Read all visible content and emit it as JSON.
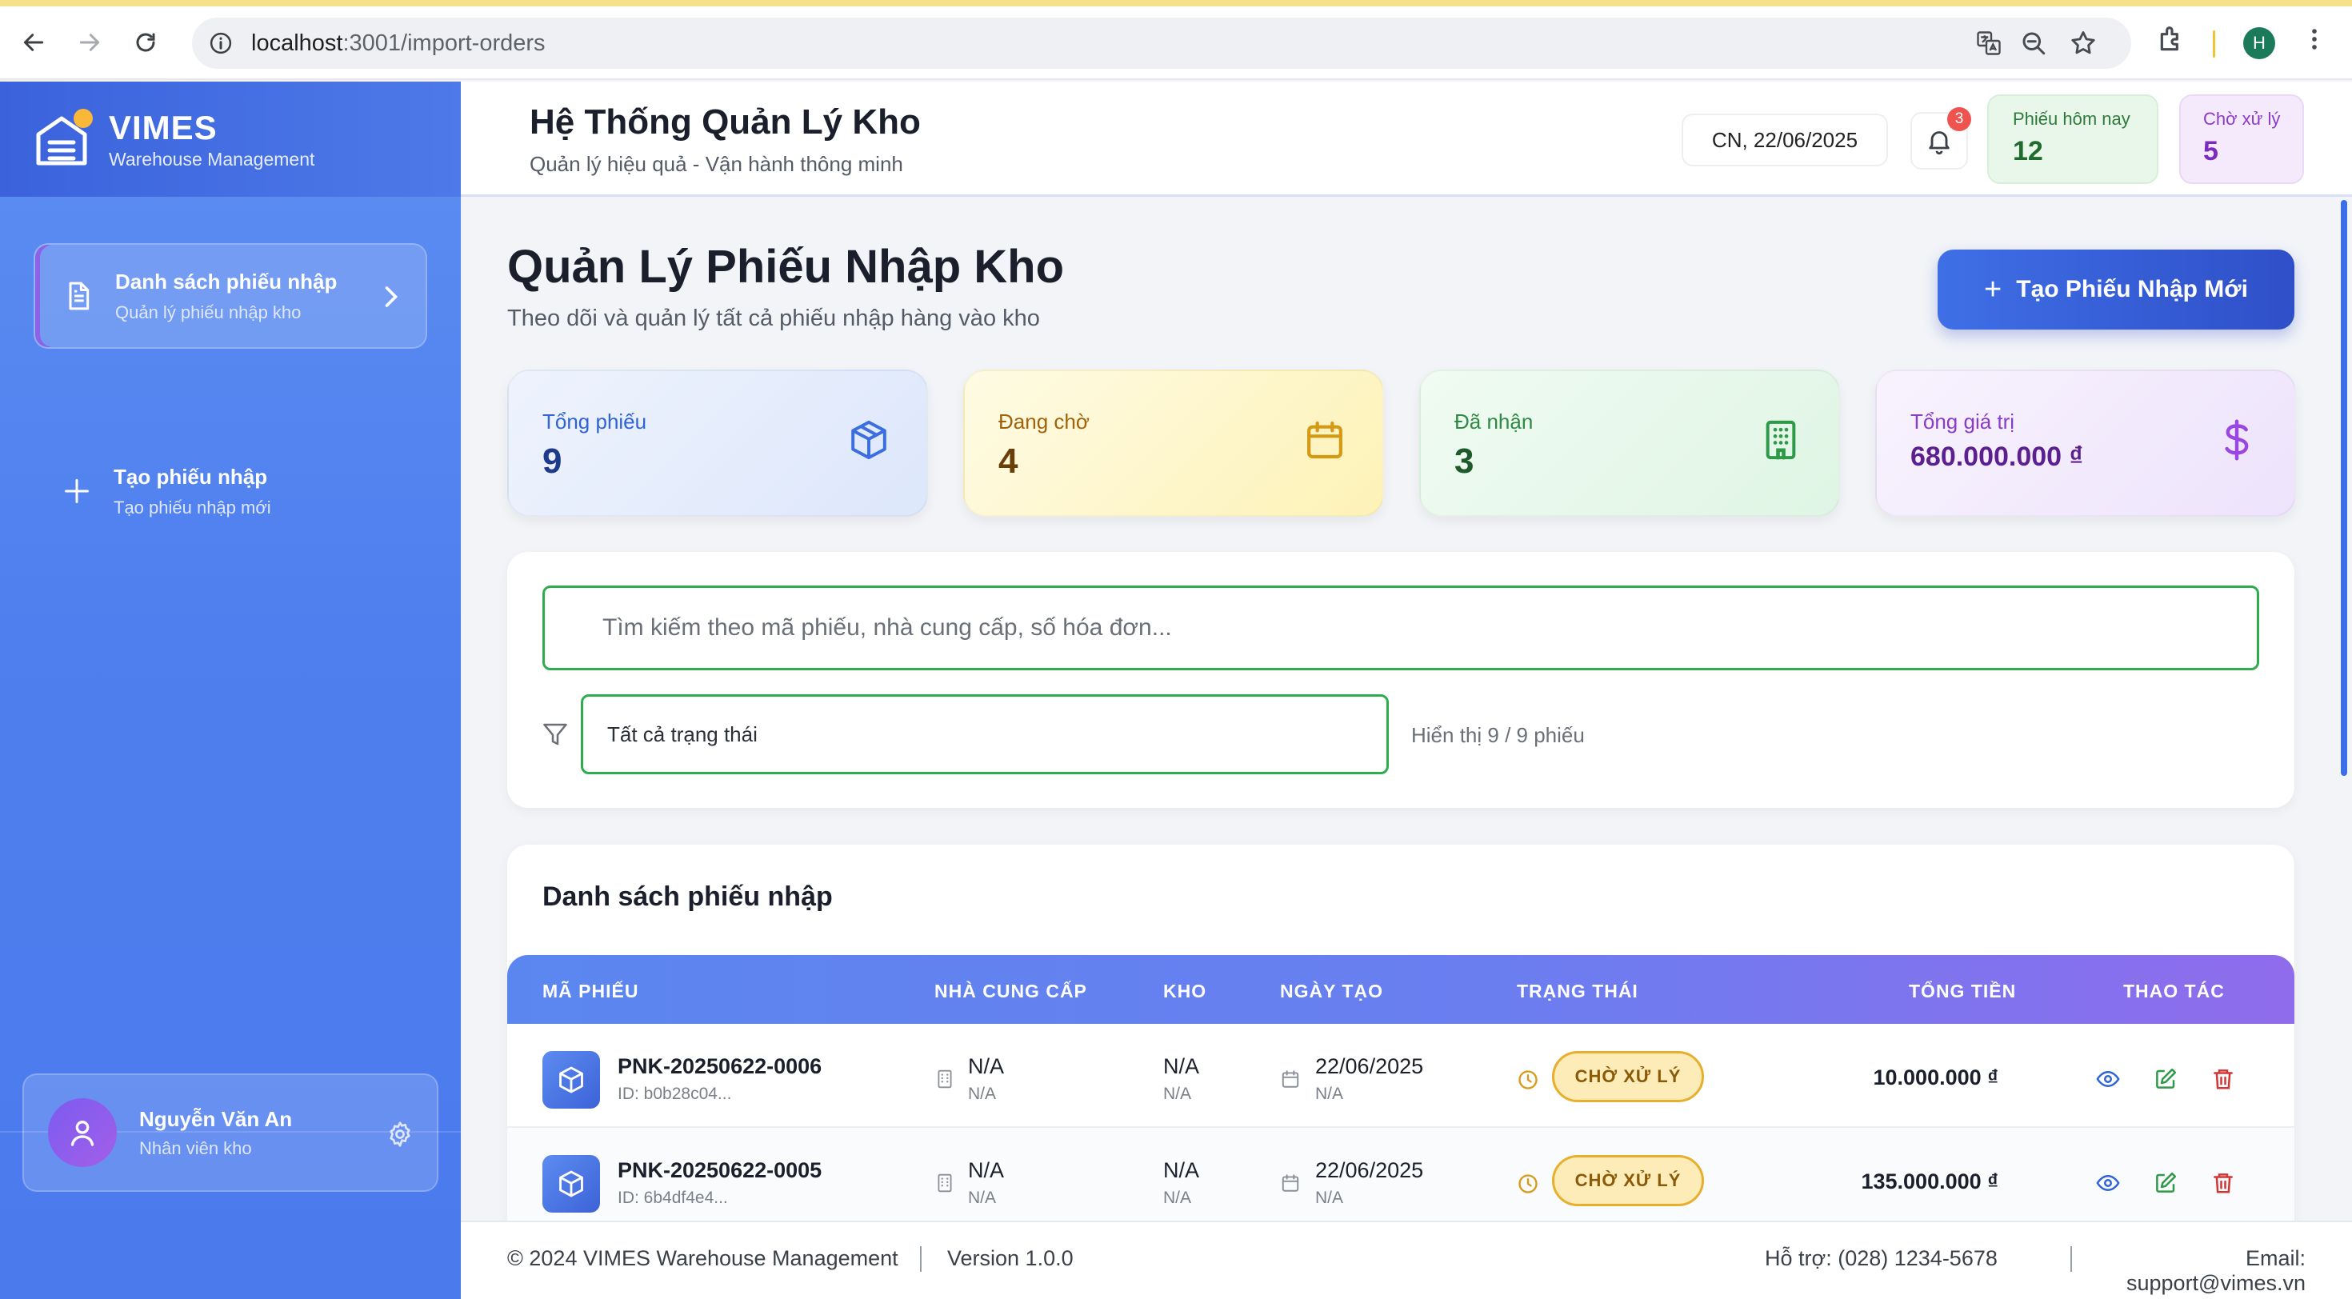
{
  "browser": {
    "url_host": "localhost",
    "url_path": ":3001/import-orders",
    "profile_initial": "H"
  },
  "brand": {
    "name": "VIMES",
    "tagline": "Warehouse Management"
  },
  "sidebar": {
    "items": [
      {
        "label": "Danh sách phiếu nhập",
        "sublabel": "Quản lý phiếu nhập kho"
      },
      {
        "label": "Tạo phiếu nhập",
        "sublabel": "Tạo phiếu nhập mới"
      }
    ],
    "user": {
      "name": "Nguyễn Văn An",
      "role": "Nhân viên kho"
    }
  },
  "header": {
    "title": "Hệ Thống Quản Lý Kho",
    "subtitle": "Quản lý hiệu quả - Vận hành thông minh",
    "date": "CN, 22/06/2025",
    "notifications": "3",
    "today_label": "Phiếu hôm nay",
    "today_value": "12",
    "pending_label": "Chờ xử lý",
    "pending_value": "5"
  },
  "page": {
    "title": "Quản Lý Phiếu Nhập Kho",
    "subtitle": "Theo dõi và quản lý tất cả phiếu nhập hàng vào kho",
    "create_button": "Tạo Phiếu Nhập Mới"
  },
  "stats": [
    {
      "label": "Tổng phiếu",
      "value": "9",
      "icon": "box-icon",
      "color": "#2f63d6"
    },
    {
      "label": "Đang chờ",
      "value": "4",
      "icon": "calendar-icon",
      "color": "#a3620a"
    },
    {
      "label": "Đã nhận",
      "value": "3",
      "icon": "building-icon",
      "color": "#2e9a48"
    },
    {
      "label": "Tổng giá trị",
      "value": "680.000.000 ₫",
      "icon": "dollar-icon",
      "color": "#8a3cc8"
    }
  ],
  "search": {
    "placeholder": "Tìm kiếm theo mã phiếu, nhà cung cấp, số hóa đơn...",
    "status_filter": "Tất cả trạng thái",
    "showing": "Hiển thị 9 / 9 phiếu"
  },
  "table": {
    "title": "Danh sách phiếu nhập",
    "columns": [
      "MÃ PHIẾU",
      "NHÀ CUNG CẤP",
      "KHO",
      "NGÀY TẠO",
      "TRẠNG THÁI",
      "TỔNG TIỀN",
      "THAO TÁC"
    ],
    "rows": [
      {
        "code": "PNK-20250622-0006",
        "id": "ID: b0b28c04...",
        "supplier": "N/A",
        "supplier_sub": "N/A",
        "warehouse": "N/A",
        "warehouse_sub": "N/A",
        "date": "22/06/2025",
        "date_sub": "N/A",
        "status": "CHỜ XỬ LÝ",
        "total": "10.000.000 ₫"
      },
      {
        "code": "PNK-20250622-0005",
        "id": "ID: 6b4df4e4...",
        "supplier": "N/A",
        "supplier_sub": "N/A",
        "warehouse": "N/A",
        "warehouse_sub": "N/A",
        "date": "22/06/2025",
        "date_sub": "N/A",
        "status": "CHỜ XỬ LÝ",
        "total": "135.000.000 ₫"
      }
    ]
  },
  "footer": {
    "copyright": "© 2024 VIMES Warehouse Management",
    "version": "Version 1.0.0",
    "support": "Hỗ trợ: (028) 1234-5678",
    "email": "Email: support@vimes.vn"
  }
}
